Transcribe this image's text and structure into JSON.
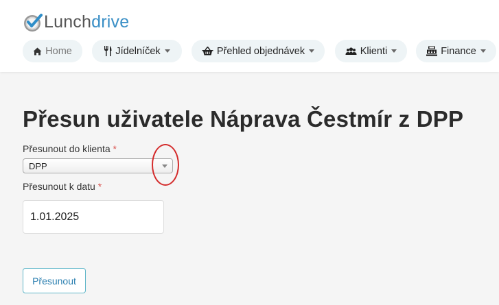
{
  "brand": {
    "name_part1": "Lunch",
    "name_part2": "drive",
    "color_primary": "#3a8fc6",
    "color_text": "#555555"
  },
  "nav": {
    "items": [
      {
        "label": "Home",
        "icon": "home-icon",
        "has_dropdown": false
      },
      {
        "label": "Jídelníček",
        "icon": "utensils-icon",
        "has_dropdown": true
      },
      {
        "label": "Přehled objednávek",
        "icon": "basket-icon",
        "has_dropdown": true
      },
      {
        "label": "Klienti",
        "icon": "users-icon",
        "has_dropdown": true
      },
      {
        "label": "Finance",
        "icon": "cash-register-icon",
        "has_dropdown": true
      }
    ]
  },
  "page": {
    "title": "Přesun uživatele Náprava Čestmír z DPP"
  },
  "form": {
    "client_label": "Přesunout do klienta",
    "client_value": "DPP",
    "date_label": "Přesunout k datu",
    "date_value": "1.01.2025",
    "required_marker": "*",
    "submit_label": "Přesunout"
  },
  "colors": {
    "required": "#d9534f",
    "annotation": "#d42b2b",
    "button_border": "#5fb6c8"
  }
}
